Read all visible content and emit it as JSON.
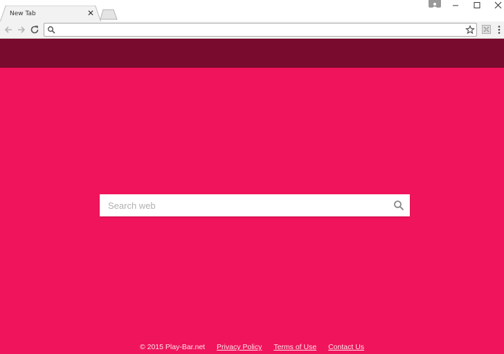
{
  "browser": {
    "tab_title": "New Tab",
    "tab_close_glyph": "✕",
    "address_value": ""
  },
  "page": {
    "header_color": "#780b2e",
    "background_color": "#ef145b",
    "search": {
      "placeholder": "Search web",
      "icon": "search-icon"
    },
    "footer": {
      "copyright": "© 2015 Play-Bar.net",
      "links": [
        {
          "label": "Privacy Policy"
        },
        {
          "label": "Terms of Use"
        },
        {
          "label": "Contact Us"
        }
      ]
    }
  }
}
